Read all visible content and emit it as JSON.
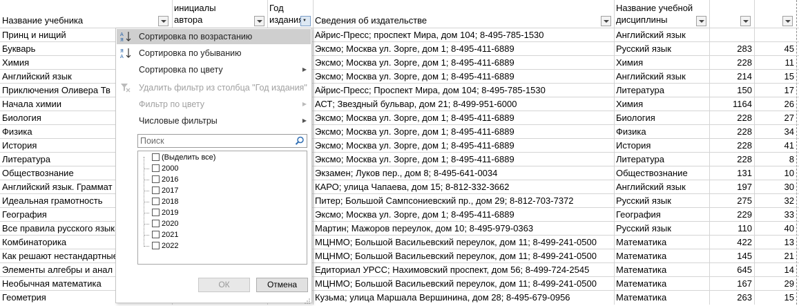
{
  "headers": {
    "col_a": "Название учебника",
    "col_b": "Фамилия и инициалы автора",
    "col_c": "Год издания",
    "col_d": "Сведения об издательстве",
    "col_e": "Название учебной дисциплины",
    "col_f": "",
    "col_g": ""
  },
  "rows": [
    {
      "title": "Принц и нищий",
      "publisher": "Айрис-Пресс; проспект Мира, дом 104; 8-495-785-1530",
      "subject": "Английский язык",
      "n1": "",
      "n2": ""
    },
    {
      "title": "Букварь",
      "publisher": "Эксмо; Москва ул. Зорге, дом 1; 8-495-411-6889",
      "subject": "Русский язык",
      "n1": "283",
      "n2": "45"
    },
    {
      "title": "Химия",
      "publisher": "Эксмо; Москва ул. Зорге, дом 1; 8-495-411-6889",
      "subject": "Химия",
      "n1": "228",
      "n2": "11"
    },
    {
      "title": "Английский язык",
      "publisher": "Эксмо; Москва ул. Зорге, дом 1; 8-495-411-6889",
      "subject": "Английский язык",
      "n1": "214",
      "n2": "15"
    },
    {
      "title": "Приключения Оливера Тв",
      "publisher": "Айрис-Пресс; Проспект Мира, дом 104; 8-495-785-1530",
      "subject": "Литература",
      "n1": "150",
      "n2": "17"
    },
    {
      "title": "Начала химии",
      "publisher": "АСТ; Звездный бульвар, дом 21; 8-499-951-6000",
      "subject": "Химия",
      "n1": "1164",
      "n2": "26"
    },
    {
      "title": "Биология",
      "publisher": "Эксмо; Москва ул. Зорге, дом 1; 8-495-411-6889",
      "subject": "Биология",
      "n1": "228",
      "n2": "27"
    },
    {
      "title": "Физика",
      "publisher": "Эксмо; Москва ул. Зорге, дом 1; 8-495-411-6889",
      "subject": "Физика",
      "n1": "228",
      "n2": "34"
    },
    {
      "title": "История",
      "publisher": "Эксмо; Москва ул. Зорге, дом 1; 8-495-411-6889",
      "subject": "История",
      "n1": "228",
      "n2": "41"
    },
    {
      "title": "Литература",
      "publisher": "Эксмо; Москва ул. Зорге, дом 1; 8-495-411-6889",
      "subject": "Литература",
      "n1": "228",
      "n2": "8"
    },
    {
      "title": "Обществознание",
      "publisher": "Экзамен; Луков пер., дом 8; 8-495-641-0034",
      "subject": "Обществознание",
      "n1": "131",
      "n2": "10"
    },
    {
      "title": "Английский язык. Граммат",
      "publisher": "КАРО; улица Чапаева, дом 15; 8-812-332-3662",
      "subject": "Английский язык",
      "n1": "197",
      "n2": "30"
    },
    {
      "title": "Идеальная грамотность",
      "publisher": "Питер; Большой Сампсониевский пр., дом 29; 8-812-703-7372",
      "subject": "Русский язык",
      "n1": "275",
      "n2": "32"
    },
    {
      "title": "География",
      "publisher": "Эксмо; Москва ул. Зорге, дом 1; 8-495-411-6889",
      "subject": "География",
      "n1": "229",
      "n2": "33"
    },
    {
      "title": "Все правила русского языка",
      "publisher": "Мартин; Мажоров переулок, дом 10; 8-495-979-0363",
      "subject": "Русский язык",
      "n1": "110",
      "n2": "40"
    },
    {
      "title": "Комбинаторика",
      "publisher": "МЦНМО; Большой Васильевский переулок, дом 11; 8-499-241-0500",
      "subject": "Математика",
      "n1": "422",
      "n2": "13"
    },
    {
      "title": "Как решают нестандартные",
      "publisher": "МЦНМО; Большой Васильевский переулок, дом 11; 8-499-241-0500",
      "subject": "Математика",
      "n1": "145",
      "n2": "21"
    },
    {
      "title": "Элементы алгебры и анал",
      "publisher": "Едиториал УРСС; Нахимовский проспект, дом 56; 8-499-724-2545",
      "subject": "Математика",
      "n1": "645",
      "n2": "14"
    },
    {
      "title": "Необычная математика",
      "publisher": "МЦНМО; Большой Васильевский переулок, дом 11; 8-499-241-0500",
      "subject": "Математика",
      "n1": "167",
      "n2": "29"
    },
    {
      "title": "Геометрия",
      "publisher": "Кузьма; улица Маршала Вершинина, дом 28; 8-495-679-0956",
      "subject": "Математика",
      "n1": "263",
      "n2": "15"
    }
  ],
  "menu": {
    "sort_asc": "Сортировка по возрастанию",
    "sort_desc": "Сортировка по убыванию",
    "sort_color": "Сортировка по цвету",
    "clear_filter": "Удалить фильтр из столбца \"Год издания\"",
    "filter_color": "Фильтр по цвету",
    "number_filters": "Числовые фильтры",
    "search_placeholder": "Поиск",
    "select_all": "(Выделить все)",
    "years": [
      "2000",
      "2016",
      "2017",
      "2018",
      "2019",
      "2020",
      "2021",
      "2022"
    ],
    "ok": "ОК",
    "cancel": "Отмена"
  },
  "icons": {
    "sort_asc": "sort-az-icon",
    "sort_desc": "sort-za-icon",
    "clear_filter": "clear-filter-icon",
    "search": "search-icon"
  }
}
